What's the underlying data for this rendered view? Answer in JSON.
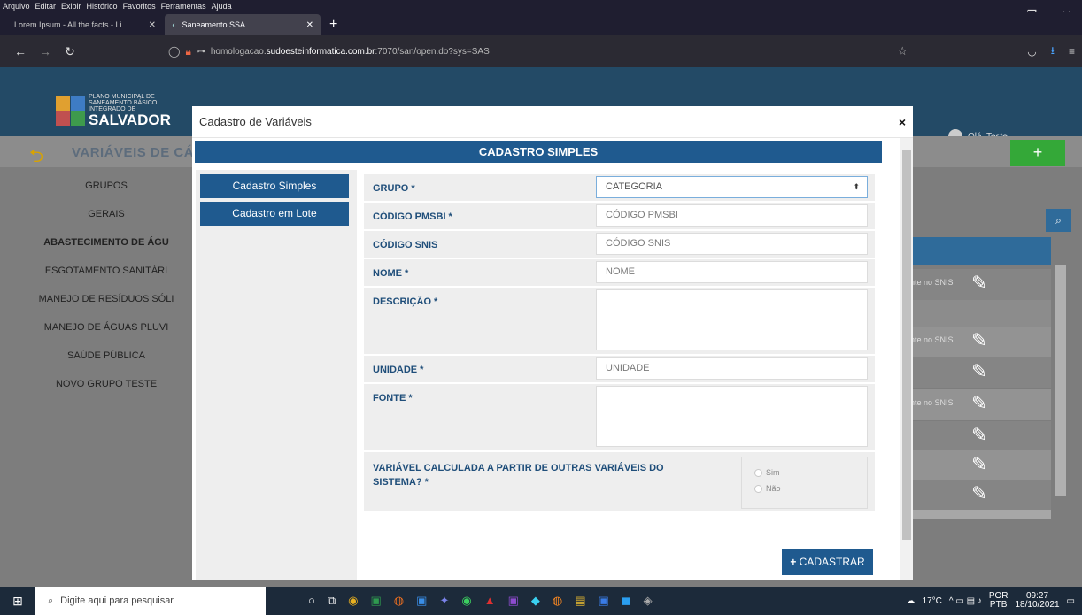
{
  "browser": {
    "menu": [
      "Arquivo",
      "Editar",
      "Exibir",
      "Histórico",
      "Favoritos",
      "Ferramentas",
      "Ajuda"
    ],
    "tabs": [
      {
        "label": "Lorem Ipsum - All the facts - Li"
      },
      {
        "label": "Saneamento SSA"
      }
    ],
    "url_prefix": "homologacao.",
    "url_domain": "sudoesteinformatica.com.br",
    "url_rest": ":7070/san/open.do?sys=SAS"
  },
  "app": {
    "logo_small": "PLANO MUNICIPAL DE SANEAMENTO BÁSICO INTEGRADO DE",
    "logo_big": "SALVADOR",
    "user_greeting": "Olá, Teste",
    "page_title": "VARIÁVEIS DE CÁL",
    "add_label": "+",
    "left_nav": [
      {
        "label": "GRUPOS",
        "bold": false
      },
      {
        "label": "GERAIS",
        "bold": false
      },
      {
        "label": "ABASTECIMENTO DE ÁGU",
        "bold": true
      },
      {
        "label": "ESGOTAMENTO SANITÁRI",
        "bold": false
      },
      {
        "label": "MANEJO DE RESÍDUOS SÓLI",
        "bold": false
      },
      {
        "label": "MANEJO DE ÁGUAS PLUVI",
        "bold": false
      },
      {
        "label": "SAÚDE PÚBLICA",
        "bold": false
      },
      {
        "label": "NOVO GRUPO TESTE",
        "bold": false
      }
    ],
    "right_rows": [
      "nte no SNIS",
      "",
      "nte no SNIS",
      "",
      "nte no SNIS",
      "",
      "",
      ""
    ]
  },
  "modal": {
    "title": "Cadastro de Variáveis",
    "header": "CADASTRO SIMPLES",
    "side_buttons": [
      "Cadastro Simples",
      "Cadastro em Lote"
    ],
    "fields": {
      "grupo": {
        "label": "GRUPO *",
        "value": "CATEGORIA"
      },
      "codigo_pmsbi": {
        "label": "CÓDIGO PMSBI *",
        "placeholder": "CÓDIGO PMSBI"
      },
      "codigo_snis": {
        "label": "CÓDIGO SNIS",
        "placeholder": "CÓDIGO SNIS"
      },
      "nome": {
        "label": "NOME *",
        "placeholder": "NOME"
      },
      "descricao": {
        "label": "DESCRIÇÃO *"
      },
      "unidade": {
        "label": "UNIDADE *",
        "placeholder": "UNIDADE"
      },
      "fonte": {
        "label": "FONTE *"
      },
      "calculada": {
        "label1": "VARIÁVEL CALCULADA A PARTIR DE OUTRAS VARIÁVEIS DO",
        "label2": "SISTEMA? *",
        "options": [
          "Sim",
          "Não"
        ]
      }
    },
    "submit": "CADASTRAR"
  },
  "taskbar": {
    "search_placeholder": "Digite aqui para pesquisar",
    "weather": "17°C",
    "lang1": "POR",
    "lang2": "PTB",
    "time": "09:27",
    "date": "18/10/2021"
  }
}
